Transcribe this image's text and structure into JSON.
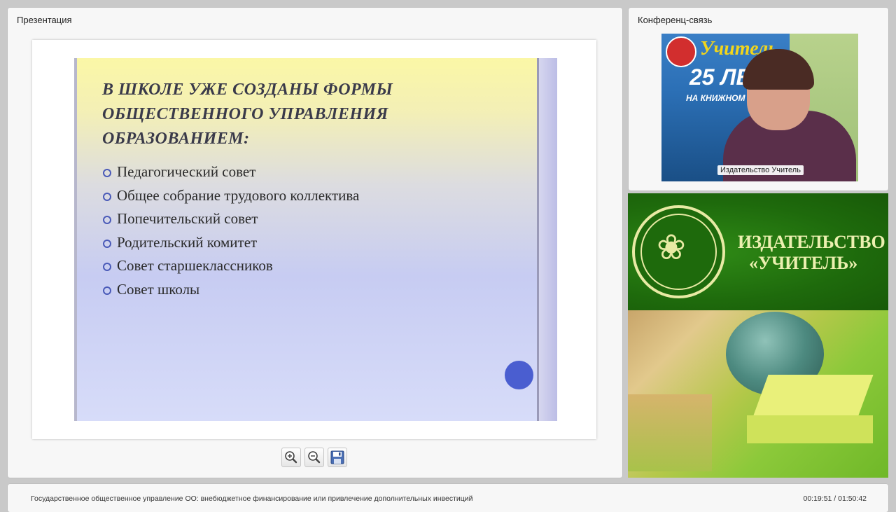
{
  "presentation_panel": {
    "title": "Презентация"
  },
  "slide": {
    "heading_lines": [
      "В ШКОЛЕ УЖЕ  СОЗДАНЫ ФОРМЫ",
      "ОБЩЕСТВЕННОГО УПРАВЛЕНИЯ",
      "ОБРАЗОВАНИЕМ:"
    ],
    "bullets": [
      "Педагогический совет",
      "Общее собрание трудового коллектива",
      "Попечительский совет",
      "Родительский комитет",
      "Совет старшеклассников",
      "Совет школы"
    ]
  },
  "toolbar": {
    "icons": [
      "zoom-in-icon",
      "zoom-out-icon",
      "save-icon"
    ]
  },
  "conference_panel": {
    "title": "Конференц-связь",
    "participant_name": "Издательство Учитель",
    "backdrop": {
      "title": "Учитель",
      "years": "25 ЛЕТ",
      "subtitle": "НА КНИЖНОМ Р... РОСС..."
    }
  },
  "banner": {
    "line1": "ИЗДАТЕЛЬСТВО",
    "line2": "«УЧИТЕЛЬ»"
  },
  "footer": {
    "title": "Государственное общественное управление ОО: внебюджетное финансирование или привлечение дополнительных инвестиций",
    "time": "00:19:51 / 01:50:42"
  },
  "colors": {
    "accent": "#4a5ed0",
    "banner_green": "#1e6a0c",
    "banner_text": "#ecf0b0"
  }
}
